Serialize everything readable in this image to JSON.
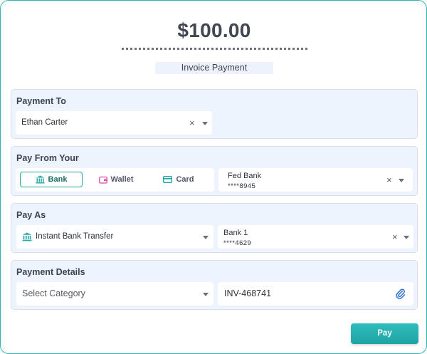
{
  "header": {
    "amount": "$100.00",
    "invoice_label": "Invoice Payment"
  },
  "payment_to": {
    "title": "Payment To",
    "recipient": "Ethan Carter",
    "clear_symbol": "×"
  },
  "pay_from": {
    "title": "Pay From Your",
    "tabs": [
      {
        "label": "Bank",
        "icon": "bank-icon",
        "selected": true
      },
      {
        "label": "Wallet",
        "icon": "wallet-icon",
        "selected": false
      },
      {
        "label": "Card",
        "icon": "card-icon",
        "selected": false
      }
    ],
    "account_name": "Fed Bank",
    "account_number": "****8945",
    "clear_symbol": "×"
  },
  "pay_as": {
    "title": "Pay As",
    "method": "Instant Bank Transfer",
    "method_icon": "bank-icon",
    "account_name": "Bank 1",
    "account_number": "****4629",
    "clear_symbol": "×"
  },
  "payment_details": {
    "title": "Payment Details",
    "category_placeholder": "Select Category",
    "invoice_number": "INV-468741",
    "attach_icon": "paperclip-icon"
  },
  "actions": {
    "pay_label": "Pay"
  },
  "colors": {
    "accent": "#2aa8a4",
    "section_bg": "#eef4fd",
    "wallet_icon": "#e0479e",
    "card_icon": "#1aa3a3"
  }
}
